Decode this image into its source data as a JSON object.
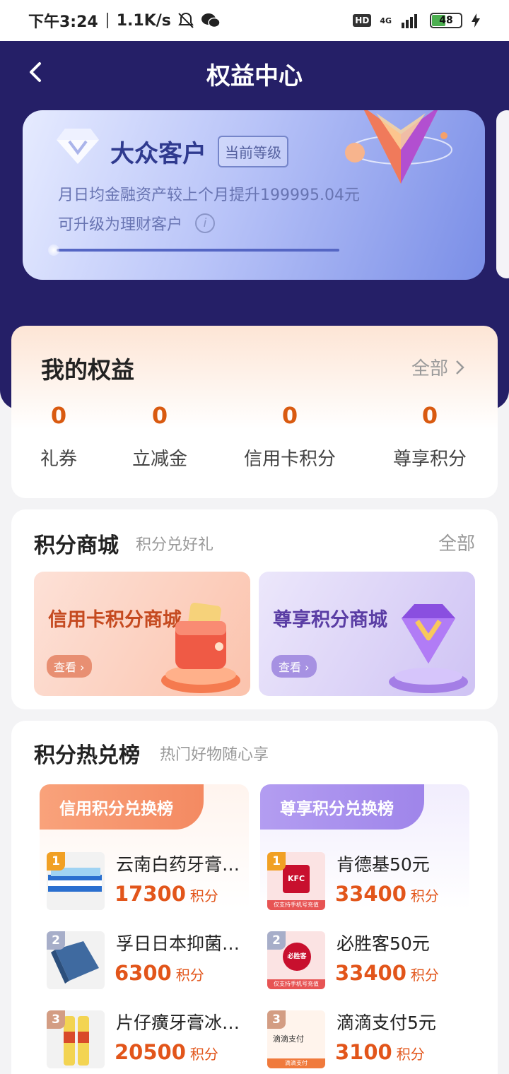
{
  "status_bar": {
    "time": "下午3:24",
    "speed": "1.1K/s",
    "hd": "HD",
    "network": "4G",
    "battery": "48"
  },
  "header": {
    "title": "权益中心"
  },
  "level_card": {
    "name": "大众客户",
    "tag": "当前等级",
    "desc_line1": "月日均金融资产较上个月提升199995.04元",
    "desc_line2": "可升级为理财客户",
    "info": "i"
  },
  "my_rights": {
    "title": "我的权益",
    "all_label": "全部",
    "stats": [
      {
        "value": "0",
        "label": "礼券"
      },
      {
        "value": "0",
        "label": "立减金"
      },
      {
        "value": "0",
        "label": "信用卡积分"
      },
      {
        "value": "0",
        "label": "尊享积分"
      }
    ]
  },
  "points_mall": {
    "title": "积分商城",
    "subtitle": "积分兑好礼",
    "all_label": "全部",
    "tiles": [
      {
        "title": "信用卡积分商城",
        "button": "查看"
      },
      {
        "title": "尊享积分商城",
        "button": "查看"
      }
    ]
  },
  "hot_rank": {
    "title": "积分热兑榜",
    "subtitle": "热门好物随心享",
    "columns": [
      {
        "header": "信用积分兑换榜",
        "items": [
          {
            "rank": "1",
            "name": "云南白药牙膏…",
            "points": "17300",
            "unit": "积分"
          },
          {
            "rank": "2",
            "name": "孚日日本抑菌…",
            "points": "6300",
            "unit": "积分"
          },
          {
            "rank": "3",
            "name": "片仔癀牙膏冰…",
            "points": "20500",
            "unit": "积分"
          }
        ]
      },
      {
        "header": "尊享积分兑换榜",
        "items": [
          {
            "rank": "1",
            "name": "肯德基50元",
            "points": "33400",
            "unit": "积分",
            "thumb_logo": "KFC",
            "thumb_note": "仅支持手机号充值"
          },
          {
            "rank": "2",
            "name": "必胜客50元",
            "points": "33400",
            "unit": "积分",
            "thumb_logo": "必胜客",
            "thumb_note": "仅支持手机号充值"
          },
          {
            "rank": "3",
            "name": "滴滴支付5元",
            "points": "3100",
            "unit": "积分",
            "thumb_logo": "滴滴支付",
            "thumb_note": "滴滴支付"
          }
        ]
      }
    ]
  }
}
